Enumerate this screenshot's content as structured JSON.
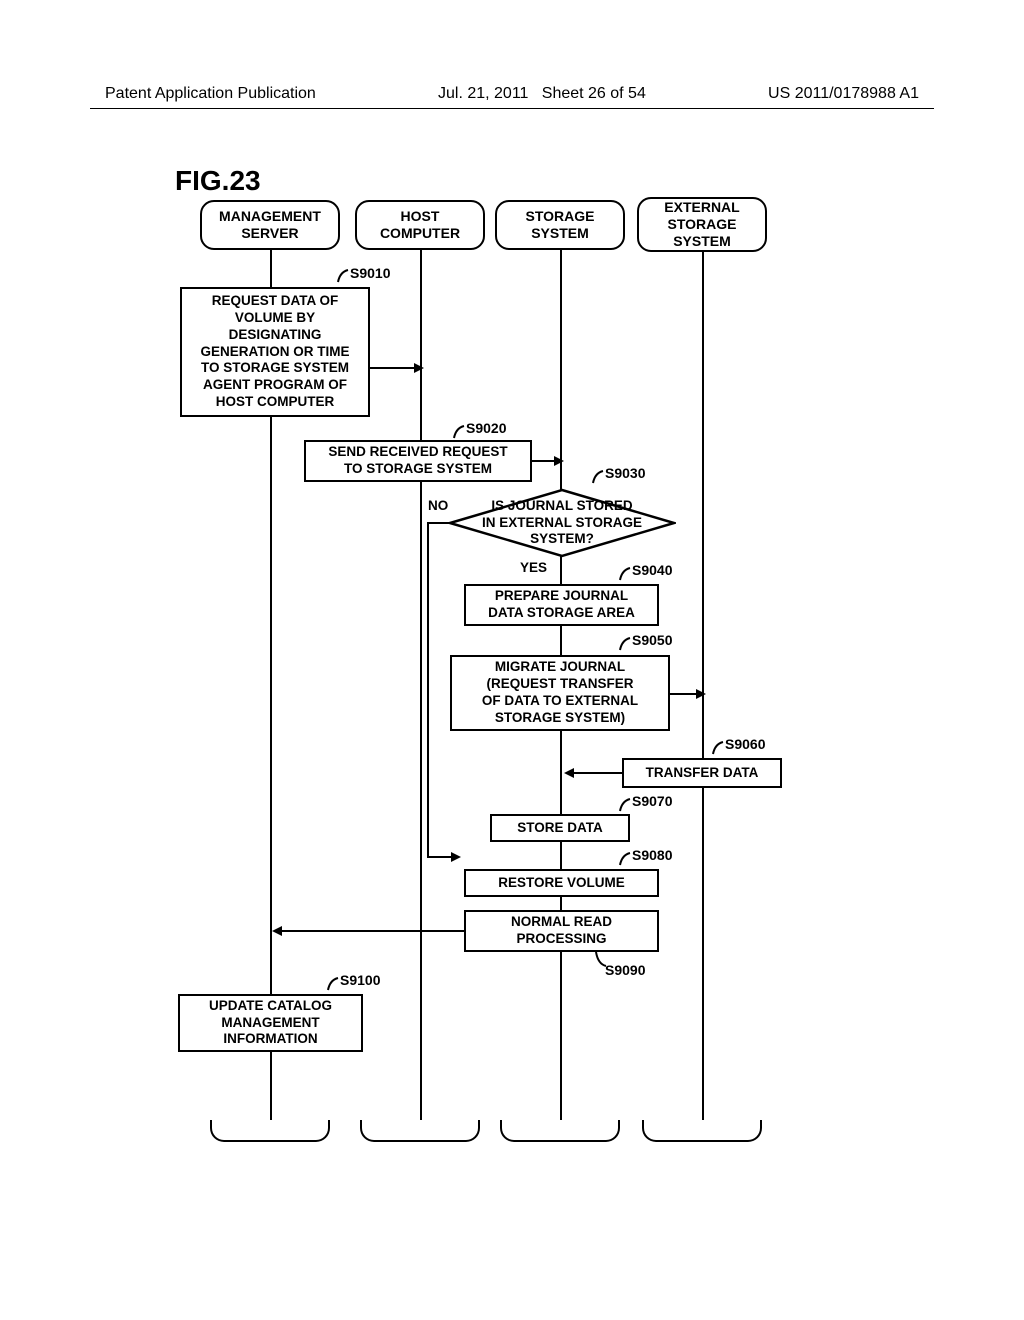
{
  "header": {
    "left": "Patent Application Publication",
    "center_date": "Jul. 21, 2011",
    "center_sheet": "Sheet 26 of 54",
    "right": "US 2011/0178988 A1"
  },
  "figure_label": "FIG.23",
  "lanes": {
    "mgmt": "MANAGEMENT\nSERVER",
    "host": "HOST\nCOMPUTER",
    "storage": "STORAGE\nSYSTEM",
    "external": "EXTERNAL\nSTORAGE\nSYSTEM"
  },
  "steps": {
    "s9010": {
      "id": "S9010",
      "text": "REQUEST DATA OF\nVOLUME BY\nDESIGNATING\nGENERATION OR TIME\nTO STORAGE SYSTEM\nAGENT PROGRAM OF\nHOST COMPUTER"
    },
    "s9020": {
      "id": "S9020",
      "text": "SEND RECEIVED REQUEST\nTO STORAGE SYSTEM"
    },
    "s9030": {
      "id": "S9030",
      "text": "IS JOURNAL STORED\nIN EXTERNAL STORAGE\nSYSTEM?"
    },
    "s9040": {
      "id": "S9040",
      "text": "PREPARE JOURNAL\nDATA STORAGE AREA"
    },
    "s9050": {
      "id": "S9050",
      "text": "MIGRATE JOURNAL\n(REQUEST TRANSFER\nOF DATA TO EXTERNAL\nSTORAGE SYSTEM)"
    },
    "s9060": {
      "id": "S9060",
      "text": "TRANSFER DATA"
    },
    "s9070": {
      "id": "S9070",
      "text": "STORE DATA"
    },
    "s9080": {
      "id": "S9080",
      "text": "RESTORE VOLUME"
    },
    "s9090": {
      "id": "S9090",
      "text": "NORMAL READ\nPROCESSING"
    },
    "s9100": {
      "id": "S9100",
      "text": "UPDATE CATALOG\nMANAGEMENT\nINFORMATION"
    }
  },
  "decision_labels": {
    "yes": "YES",
    "no": "NO"
  },
  "chart_data": {
    "type": "sequence-flowchart",
    "title": "FIG.23",
    "actors": [
      "MANAGEMENT SERVER",
      "HOST COMPUTER",
      "STORAGE SYSTEM",
      "EXTERNAL STORAGE SYSTEM"
    ],
    "steps": [
      {
        "id": "S9010",
        "actor": "MANAGEMENT SERVER",
        "type": "process",
        "text": "REQUEST DATA OF VOLUME BY DESIGNATING GENERATION OR TIME TO STORAGE SYSTEM AGENT PROGRAM OF HOST COMPUTER",
        "arrow_to": "HOST COMPUTER"
      },
      {
        "id": "S9020",
        "actor": "HOST COMPUTER",
        "type": "process",
        "text": "SEND RECEIVED REQUEST TO STORAGE SYSTEM",
        "arrow_to": "STORAGE SYSTEM"
      },
      {
        "id": "S9030",
        "actor": "STORAGE SYSTEM",
        "type": "decision",
        "text": "IS JOURNAL STORED IN EXTERNAL STORAGE SYSTEM?",
        "yes_to": "S9040",
        "no_to": "S9080"
      },
      {
        "id": "S9040",
        "actor": "STORAGE SYSTEM",
        "type": "process",
        "text": "PREPARE JOURNAL DATA STORAGE AREA"
      },
      {
        "id": "S9050",
        "actor": "STORAGE SYSTEM",
        "type": "process",
        "text": "MIGRATE JOURNAL (REQUEST TRANSFER OF DATA TO EXTERNAL STORAGE SYSTEM)",
        "arrow_to": "EXTERNAL STORAGE SYSTEM"
      },
      {
        "id": "S9060",
        "actor": "EXTERNAL STORAGE SYSTEM",
        "type": "process",
        "text": "TRANSFER DATA",
        "arrow_to": "STORAGE SYSTEM"
      },
      {
        "id": "S9070",
        "actor": "STORAGE SYSTEM",
        "type": "process",
        "text": "STORE DATA"
      },
      {
        "id": "S9080",
        "actor": "STORAGE SYSTEM",
        "type": "process",
        "text": "RESTORE VOLUME"
      },
      {
        "id": "S9090",
        "actor": "STORAGE SYSTEM",
        "type": "process",
        "text": "NORMAL READ PROCESSING",
        "arrow_to": "MANAGEMENT SERVER"
      },
      {
        "id": "S9100",
        "actor": "MANAGEMENT SERVER",
        "type": "process",
        "text": "UPDATE CATALOG MANAGEMENT INFORMATION"
      }
    ]
  }
}
